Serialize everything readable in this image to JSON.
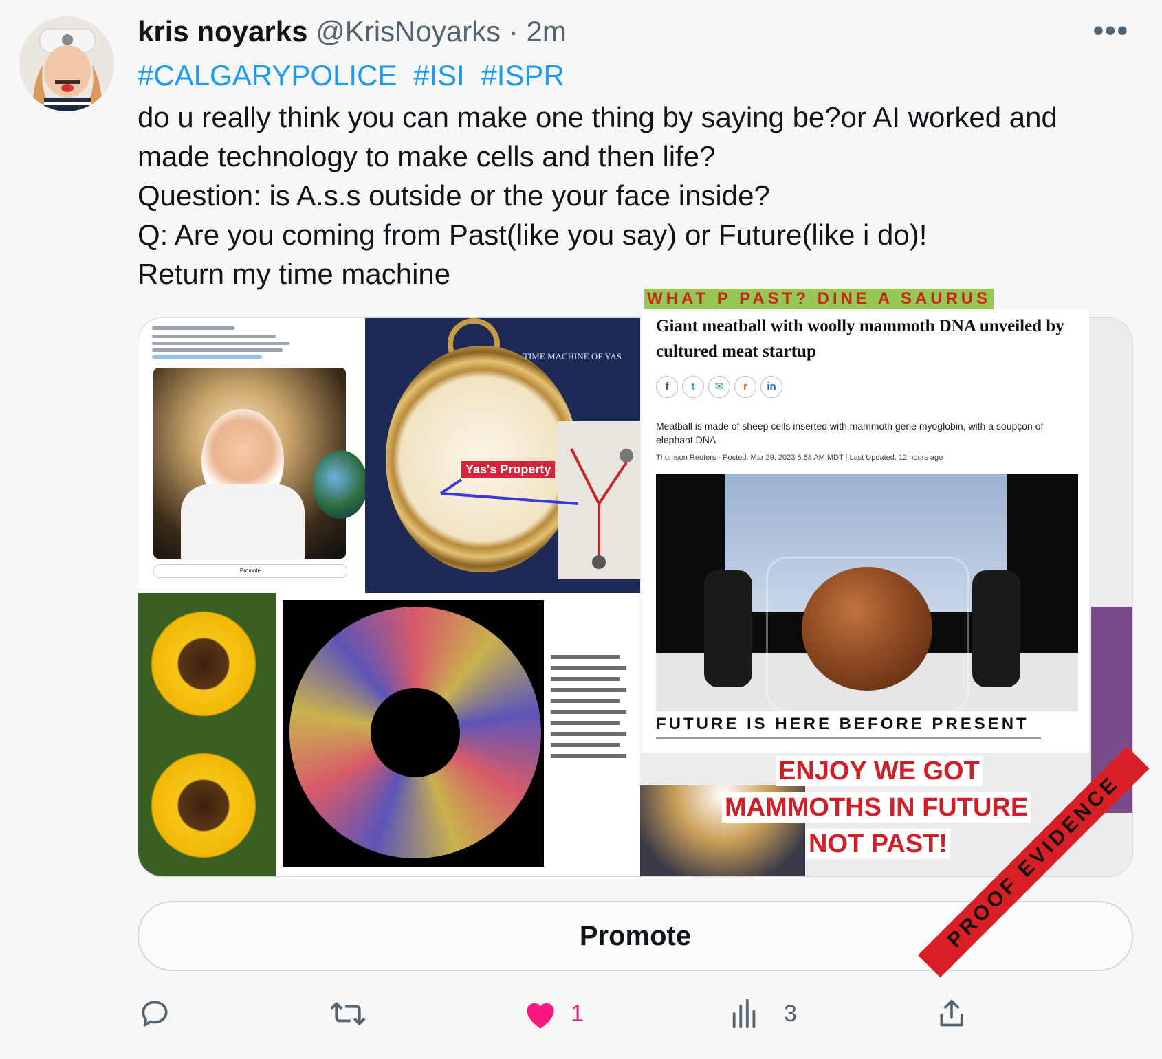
{
  "tweet": {
    "display_name": "kris noyarks",
    "handle": "@KrisNoyarks",
    "separator": "·",
    "time": "2m",
    "hashtags": [
      "#CALGARYPOLICE",
      "#ISI",
      "#ISPR"
    ],
    "lines": [
      "do u really think you can make one thing by saying be?or AI worked and",
      "made technology to make cells and then life?",
      "Question: is A.s.s outside or the your face inside?",
      "Q: Are you coming from Past(like you say) or Future(like i do)!",
      "Return my time machine"
    ],
    "more_icon": "more-horizontal-icon"
  },
  "media": {
    "watch_caption": "TIME MACHINE OF YAS",
    "watch_label": "Yas's Property",
    "mini_promote": "Promote",
    "banner": "WHAT P PAST? DINE A SAURUS",
    "article": {
      "title": "Giant meatball with woolly mammoth DNA unveiled by cultured meat startup",
      "share_icons": [
        "f",
        "t",
        "✉",
        "r",
        "in"
      ],
      "dek": "Meatball is made of sheep cells inserted with mammoth gene myoglobin, with a soupçon of elephant DNA",
      "byline": "Thomson Reuters · Posted: Mar 29, 2023 5:58 AM MDT | Last Updated: 12 hours ago",
      "caption_overlay": "FUTURE IS HERE BEFORE PRESENT"
    },
    "enjoy_lines": [
      "ENJOY WE GOT",
      "MAMMOTHS IN FUTURE",
      "NOT PAST!"
    ]
  },
  "promote_label": "Promote",
  "actions": {
    "reply_icon": "reply-icon",
    "retweet_icon": "retweet-icon",
    "like_icon": "heart-icon",
    "like_count": "1",
    "views_icon": "views-icon",
    "views_count": "3",
    "share_icon": "share-icon"
  },
  "stamp": "PROOF EVIDENCE",
  "colors": {
    "link": "#1d9bf0",
    "like": "#f91880",
    "stamp": "#d81f26",
    "banner_bg": "#96c653",
    "banner_text": "#c9261b"
  }
}
